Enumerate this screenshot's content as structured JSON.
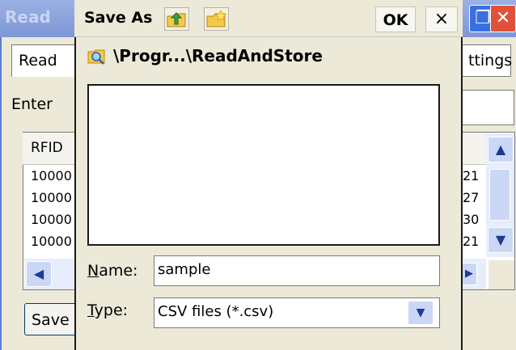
{
  "background_window": {
    "title": "Read",
    "tabs": [
      "Read",
      "ttings"
    ],
    "enter_label": "Enter",
    "list": {
      "header": "RFID",
      "rows": [
        {
          "left": "10000",
          "right": "21"
        },
        {
          "left": "10000",
          "right": "27"
        },
        {
          "left": "10000",
          "right": "30"
        },
        {
          "left": "10000",
          "right": "21"
        }
      ]
    },
    "save_label": "Save"
  },
  "dialog": {
    "title": "Save As",
    "ok_label": "OK",
    "close_label": "×",
    "path": "\\Progr...\\ReadAndStore",
    "name_label_first": "N",
    "name_label_rest": "ame:",
    "name_value": "sample",
    "type_label_first": "T",
    "type_label_rest": "ype:",
    "type_value": "CSV files (*.csv)"
  },
  "icons": {
    "up": "folder-up-icon",
    "new_folder": "new-folder-icon",
    "path": "folder-search-icon"
  },
  "colors": {
    "titlebar": "#7d97d6",
    "close_red": "#e0503a",
    "scroll_button": "#cad8f6"
  }
}
